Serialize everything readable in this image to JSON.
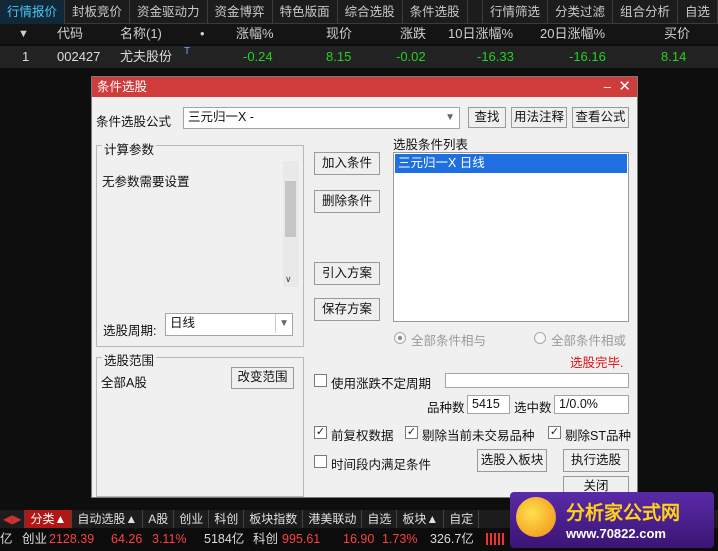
{
  "topbar": {
    "tabs": [
      "行情报价",
      "封板竞价",
      "资金驱动力",
      "资金博弈",
      "特色版面",
      "综合选股",
      "条件选股",
      "行情筛选",
      "分类过滤",
      "组合分析",
      "自选"
    ]
  },
  "table": {
    "headers": [
      "代码",
      "名称(1)",
      "涨幅%",
      "现价",
      "涨跌",
      "10日涨幅%",
      "20日涨幅%",
      "买价"
    ],
    "sort_marker": "▼",
    "dot_marker": "•",
    "row": {
      "index": "1",
      "code": "002427",
      "name": "尤夫股份",
      "name_flag": "T",
      "change_pct": "-0.24",
      "price": "8.15",
      "change": "-0.02",
      "change10": "-16.33",
      "change20": "-16.16",
      "bid": "8.14"
    }
  },
  "dialog": {
    "title": "条件选股",
    "formula_label": "条件选股公式",
    "formula_value": "三元归一X  -",
    "find_btn": "查找",
    "usage_btn": "用法注释",
    "view_btn": "查看公式",
    "params_title": "计算参数",
    "params_text": "无参数需要设置",
    "add_btn": "加入条件",
    "del_btn": "删除条件",
    "import_btn": "引入方案",
    "save_btn": "保存方案",
    "cond_list_title": "选股条件列表",
    "cond_list_items": [
      "三元归一X  日线"
    ],
    "radio_and": "全部条件相与",
    "radio_or": "全部条件相或",
    "done_text": "选股完毕.",
    "period_label": "选股周期:",
    "period_value": "日线",
    "range_title": "选股范围",
    "range_value": "全部A股",
    "change_range_btn": "改变范围",
    "use_period_label": "使用涨跌不定周期",
    "count_label": "品种数",
    "count_value": "5415",
    "selected_label": "选中数",
    "selected_value": "1/0.0%",
    "fq_label": "前复权数据",
    "exclude_untraded_label": "剔除当前未交易品种",
    "exclude_st_label": "剔除ST品种",
    "time_satisfy_label": "时间段内满足条件",
    "to_block_btn": "选股入板块",
    "exec_btn": "执行选股",
    "close_btn": "关闭",
    "check_mark": "✓",
    "close_icon": "✕",
    "min_icon": "–"
  },
  "bottom_tabs": [
    "分类▲",
    "自动选股▲",
    "A股",
    "创业",
    "科创",
    "板块指数",
    "港美联动",
    "自选",
    "板块▲",
    "自定"
  ],
  "status": {
    "left": "亿",
    "cy_label": "创业",
    "cy_value": "2128.39",
    "cy_change": "64.26",
    "cy_pct": "3.11%",
    "cy_amount": "5184亿",
    "kc_label": "科创",
    "kc_value": "995.61",
    "kc_change": "16.90",
    "kc_pct": "1.73%",
    "kc_amount": "326.7亿"
  },
  "logo": {
    "text": "分析家公式网",
    "url": "www.70822.com"
  }
}
